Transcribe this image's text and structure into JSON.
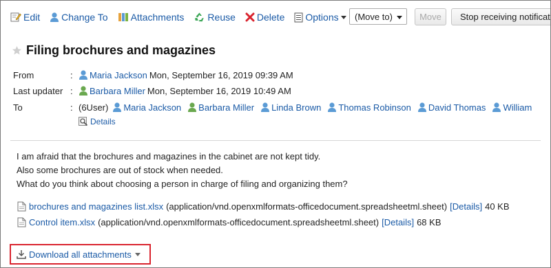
{
  "toolbar": {
    "edit": "Edit",
    "change_to": "Change To",
    "attachments": "Attachments",
    "reuse": "Reuse",
    "delete": "Delete",
    "options": "Options",
    "move_select": "(Move to)",
    "move_button": "Move",
    "stop_button": "Stop receiving notifications"
  },
  "message": {
    "title": "Filing brochures and magazines",
    "from_label": "From",
    "from_user": "Maria Jackson",
    "from_date": "Mon, September 16, 2019 09:39 AM",
    "updater_label": "Last updater",
    "updater_user": "Barbara Miller",
    "updater_date": "Mon, September 16, 2019 10:49 AM",
    "to_label": "To",
    "colon": ":",
    "to_count": "(6User)",
    "recipients": [
      "Maria Jackson",
      "Barbara Miller",
      "Linda Brown",
      "Thomas Robinson",
      "David Thomas",
      "William"
    ],
    "details": "Details",
    "body": [
      "I am afraid that the brochures and magazines in the cabinet are not kept tidy.",
      "Also some brochures are out of stock when needed.",
      "What do you think about choosing a person in charge of filing and organizing them?"
    ]
  },
  "files": [
    {
      "name": "brochures and magazines list.xlsx",
      "type": "(application/vnd.openxmlformats-officedocument.spreadsheetml.sheet)",
      "details": "[Details]",
      "size": "40 KB"
    },
    {
      "name": "Control item.xlsx",
      "type": "(application/vnd.openxmlformats-officedocument.spreadsheetml.sheet)",
      "details": "[Details]",
      "size": "68 KB"
    }
  ],
  "download_all": "Download all attachments",
  "colors": {
    "link": "#1a5aa6",
    "highlight_border": "#d9232e"
  }
}
